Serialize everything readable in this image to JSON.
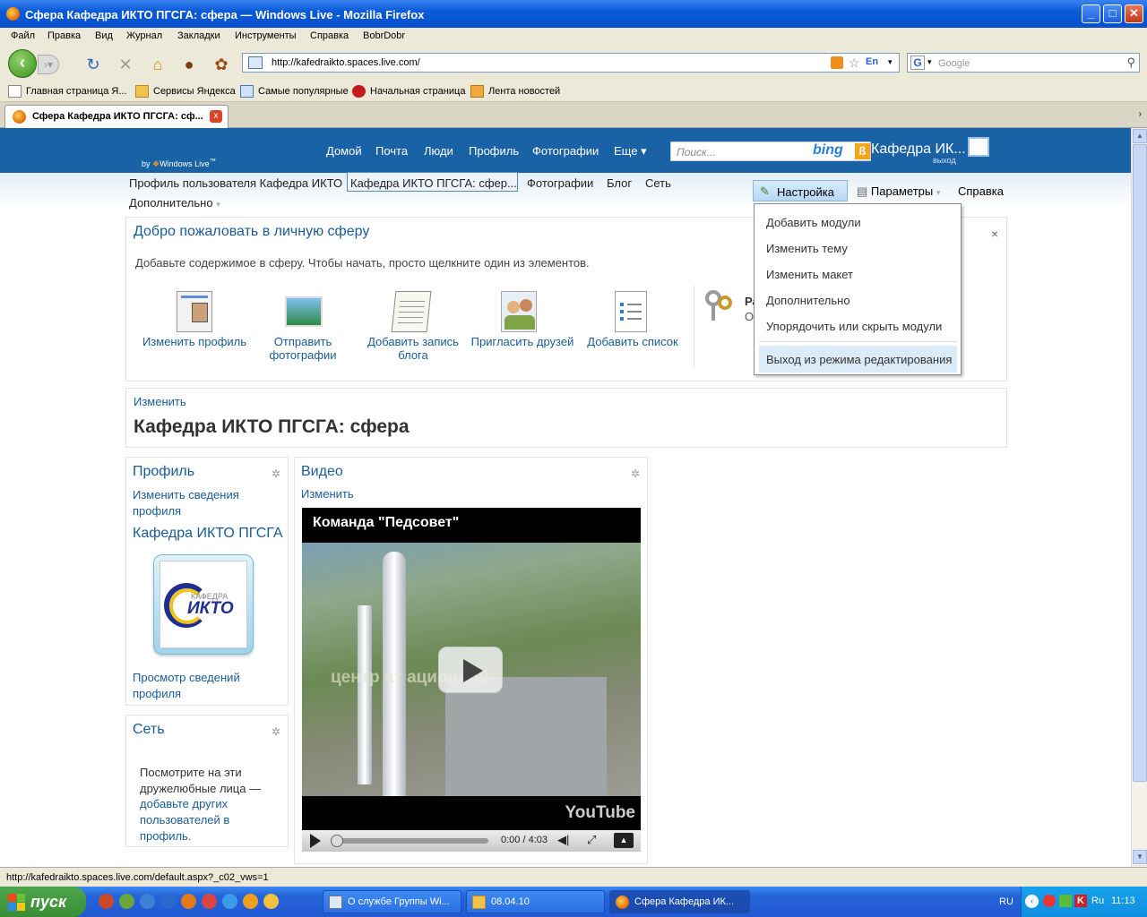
{
  "window": {
    "title": "Сфера Кафедра ИКТО ПГСГА: сфера — Windows Live - Mozilla Firefox",
    "controls": {
      "minimize": "_",
      "maximize": "□",
      "close": "✕"
    }
  },
  "menubar": [
    "Файл",
    "Правка",
    "Вид",
    "Журнал",
    "Закладки",
    "Инструменты",
    "Справка",
    "BobrDobr"
  ],
  "nav": {
    "url": "http://kafedraikto.spaces.live.com/",
    "lang": "En",
    "search_placeholder": "Google",
    "search_engine": "G"
  },
  "bookmarks": [
    "Главная страница Я...",
    "Сервисы Яндекса",
    "Самые популярные",
    "Начальная страница",
    "Лента новостей"
  ],
  "tab": {
    "title": "Сфера Кафедра ИКТО ПГСГА: сф...",
    "close": "x"
  },
  "wl": {
    "by": "by",
    "brand": "Windows Live",
    "brand_mark": "™",
    "topnav": [
      "Домой",
      "Почта",
      "Люди",
      "Профиль",
      "Фотографии",
      "Еще ▾"
    ],
    "search_placeholder": "Поиск...",
    "bing": "bing",
    "user": "Кафедра ИК... ▾",
    "exit": "выход",
    "secnav": [
      "Профиль пользователя Кафедра ИКТО",
      "Кафедра ИКТО ПГСГА: сфер...",
      "Фотографии",
      "Блог",
      "Сеть"
    ],
    "more": "Дополнительно",
    "customize": "Настройка",
    "params": "Параметры",
    "help": "Справка"
  },
  "menu": {
    "items": [
      "Добавить модули",
      "Изменить тему",
      "Изменить макет",
      "Дополнительно",
      "Упорядочить или скрыть модули"
    ],
    "exit_edit": "Выход из режима редактирования"
  },
  "welcome": {
    "title": "Добро пожаловать в личную сферу",
    "subtitle": "Добавьте содержимое в сферу. Чтобы начать, просто щелкните один из элементов.",
    "actions": [
      {
        "label": "Изменить профиль",
        "icon": "profile-icon"
      },
      {
        "label": "Отправить фотографии",
        "icon": "photo-icon"
      },
      {
        "label": "Добавить запись блога",
        "icon": "notepad-icon"
      },
      {
        "label": "Пригласить друзей",
        "icon": "friends-icon"
      },
      {
        "label": "Добавить список",
        "icon": "list-icon"
      }
    ],
    "side_title": "Ра",
    "side_text": "От",
    "close": "×"
  },
  "space": {
    "edit": "Изменить",
    "title": "Кафедра ИКТО ПГСГА: сфера"
  },
  "profile": {
    "title": "Профиль",
    "edit_info": "Изменить сведения профиля",
    "name": "Кафедра ИКТО ПГСГА",
    "logo_text": "ИКТО",
    "logo_small": "КАФЕДРА",
    "view_info": "Просмотр сведений профиля"
  },
  "network": {
    "title": "Сеть",
    "text": "Посмотрите на эти дружелюбные лица —",
    "link": "добавьте других пользователей в профиль."
  },
  "video": {
    "title": "Видео",
    "edit": "Изменить",
    "caption": "Команда \"Педсовет\"",
    "overlay": "центр  ат    ационной",
    "brand": "YouTube",
    "time": "0:00 / 4:03",
    "progress": 0
  },
  "status": "http://kafedraikto.spaces.live.com/default.aspx?_c02_vws=1",
  "taskbar": {
    "start": "пуск",
    "items": [
      "О службе Группы Wi...",
      "08.04.10",
      "Сфера Кафедра ИК..."
    ],
    "lang": "RU",
    "tray_lang": "Ru",
    "time": "11:13"
  }
}
